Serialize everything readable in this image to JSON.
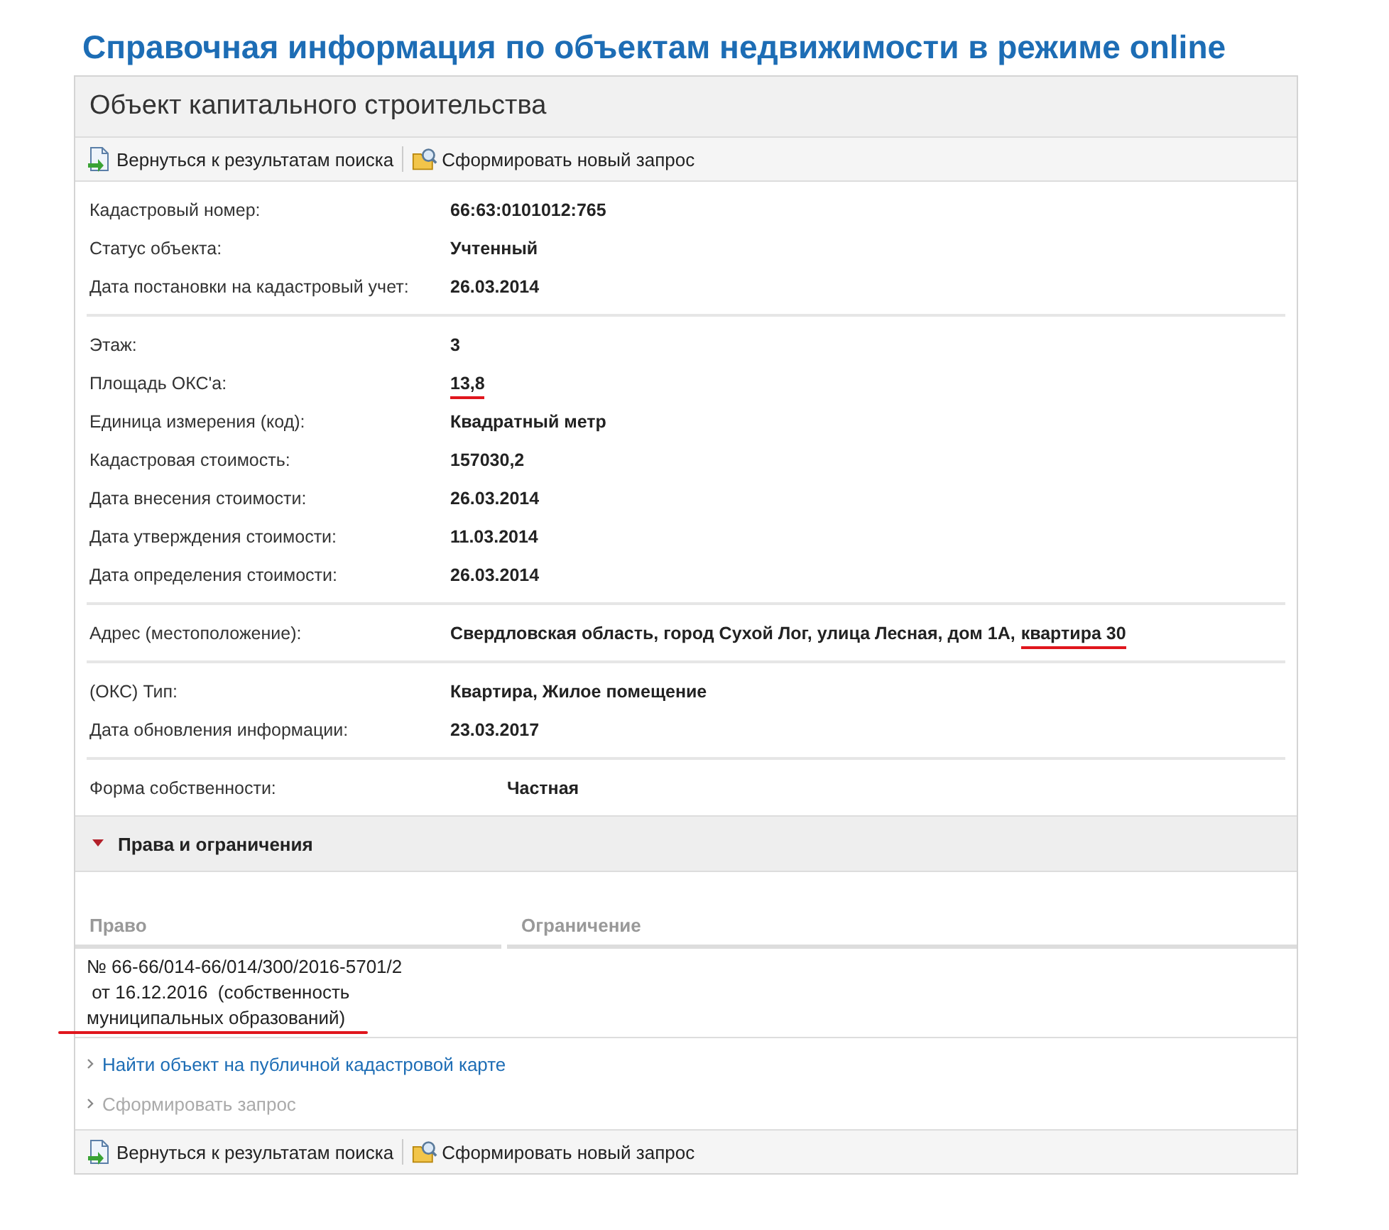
{
  "page_title": "Справочная информация по объектам недвижимости в режиме online",
  "panel": {
    "title": "Объект капитального строительства",
    "toolbars": [
      [
        {
          "kind": "back",
          "label": "Вернуться к результатам поиска"
        },
        {
          "kind": "query",
          "label": "Сформировать новый запрос"
        }
      ],
      [
        {
          "kind": "back",
          "label": "Вернуться к результатам поиска"
        },
        {
          "kind": "query",
          "label": "Сформировать новый запрос"
        }
      ]
    ],
    "sections": [
      {
        "kind": "normal",
        "fields": [
          {
            "label": "Кадастровый номер:",
            "value": [
              {
                "text": "66:63:0101012:765",
                "underlined": false
              }
            ]
          },
          {
            "label": "Статус объекта:",
            "value": [
              {
                "text": "Учтенный",
                "underlined": false
              }
            ]
          },
          {
            "label": "Дата постановки на кадастровый учет:",
            "value": [
              {
                "text": "26.03.2014",
                "underlined": false
              }
            ]
          }
        ]
      },
      {
        "kind": "normal",
        "fields": [
          {
            "label": "Этаж:",
            "value": [
              {
                "text": "3",
                "underlined": false
              }
            ]
          },
          {
            "label": "Площадь ОКС'а:",
            "value": [
              {
                "text": "13,8",
                "underlined": true
              }
            ]
          },
          {
            "label": "Единица измерения (код):",
            "value": [
              {
                "text": "Квадратный метр",
                "underlined": false
              }
            ]
          },
          {
            "label": "Кадастровая стоимость:",
            "value": [
              {
                "text": "157030,2",
                "underlined": false
              }
            ]
          },
          {
            "label": "Дата внесения стоимости:",
            "value": [
              {
                "text": "26.03.2014",
                "underlined": false
              }
            ]
          },
          {
            "label": "Дата утверждения стоимости:",
            "value": [
              {
                "text": "11.03.2014",
                "underlined": false
              }
            ]
          },
          {
            "label": "Дата определения стоимости:",
            "value": [
              {
                "text": "26.03.2014",
                "underlined": false
              }
            ]
          }
        ]
      },
      {
        "kind": "normal",
        "fields": [
          {
            "label": "Адрес (местоположение):",
            "value": [
              {
                "text": "Свердловская область, город Сухой Лог, улица Лесная, дом 1А,",
                "underlined": false
              },
              {
                "text": "квартира 30",
                "underlined": true
              }
            ]
          }
        ]
      },
      {
        "kind": "normal",
        "fields": [
          {
            "label": "(ОКС) Тип:",
            "value": [
              {
                "text": "Квартира, Жилое помещение",
                "underlined": false
              }
            ]
          },
          {
            "label": "Дата обновления информации:",
            "value": [
              {
                "text": "23.03.2017",
                "underlined": false
              }
            ]
          }
        ]
      },
      {
        "kind": "offset",
        "fields": [
          {
            "label": "Форма собственности:",
            "value": [
              {
                "text": "Частная",
                "underlined": false
              }
            ]
          }
        ]
      }
    ],
    "rights": {
      "title": "Права и ограничения",
      "expanded": true,
      "columns": [
        "Право",
        "Ограничение"
      ],
      "rows": [
        {
          "lines": [
            "№ 66-66/014-66/014/300/2016-5701/2",
            " от 16.12.2016  (собственность",
            "муниципальных образований)"
          ],
          "underlined": true
        }
      ]
    },
    "links": [
      {
        "label": "Найти объект на публичной кадастровой карте",
        "disabled": false
      },
      {
        "label": "Сформировать запрос",
        "disabled": true
      }
    ]
  }
}
